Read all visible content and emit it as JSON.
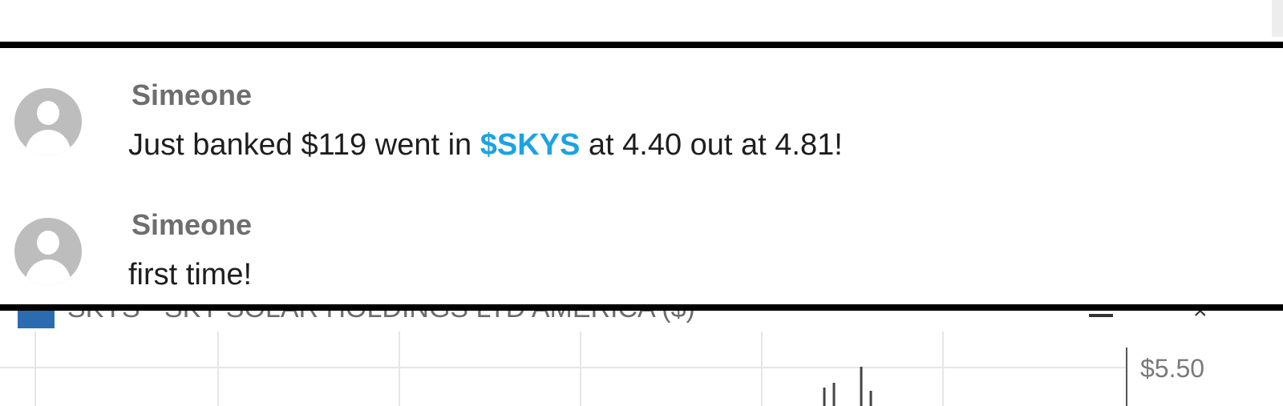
{
  "chat": {
    "messages": [
      {
        "author": "Simeone",
        "text_before": "Just banked $119 went in ",
        "cashtag": "$SKYS",
        "text_after": " at 4.40 out at 4.81!"
      },
      {
        "author": "Simeone",
        "text_before": "first time!"
      }
    ]
  },
  "chart_panel": {
    "title": "SKYS - SKY SOLAR HOLDINGS LTD AMERICA ($)",
    "minimize_icon": "minimize-icon",
    "close_icon": "close-icon",
    "price_label": "$5.50"
  },
  "colors": {
    "cashtag": "#1ba3e3",
    "author": "#6e6e6e",
    "avatar": "#bdbdbd",
    "border": "#000000"
  }
}
